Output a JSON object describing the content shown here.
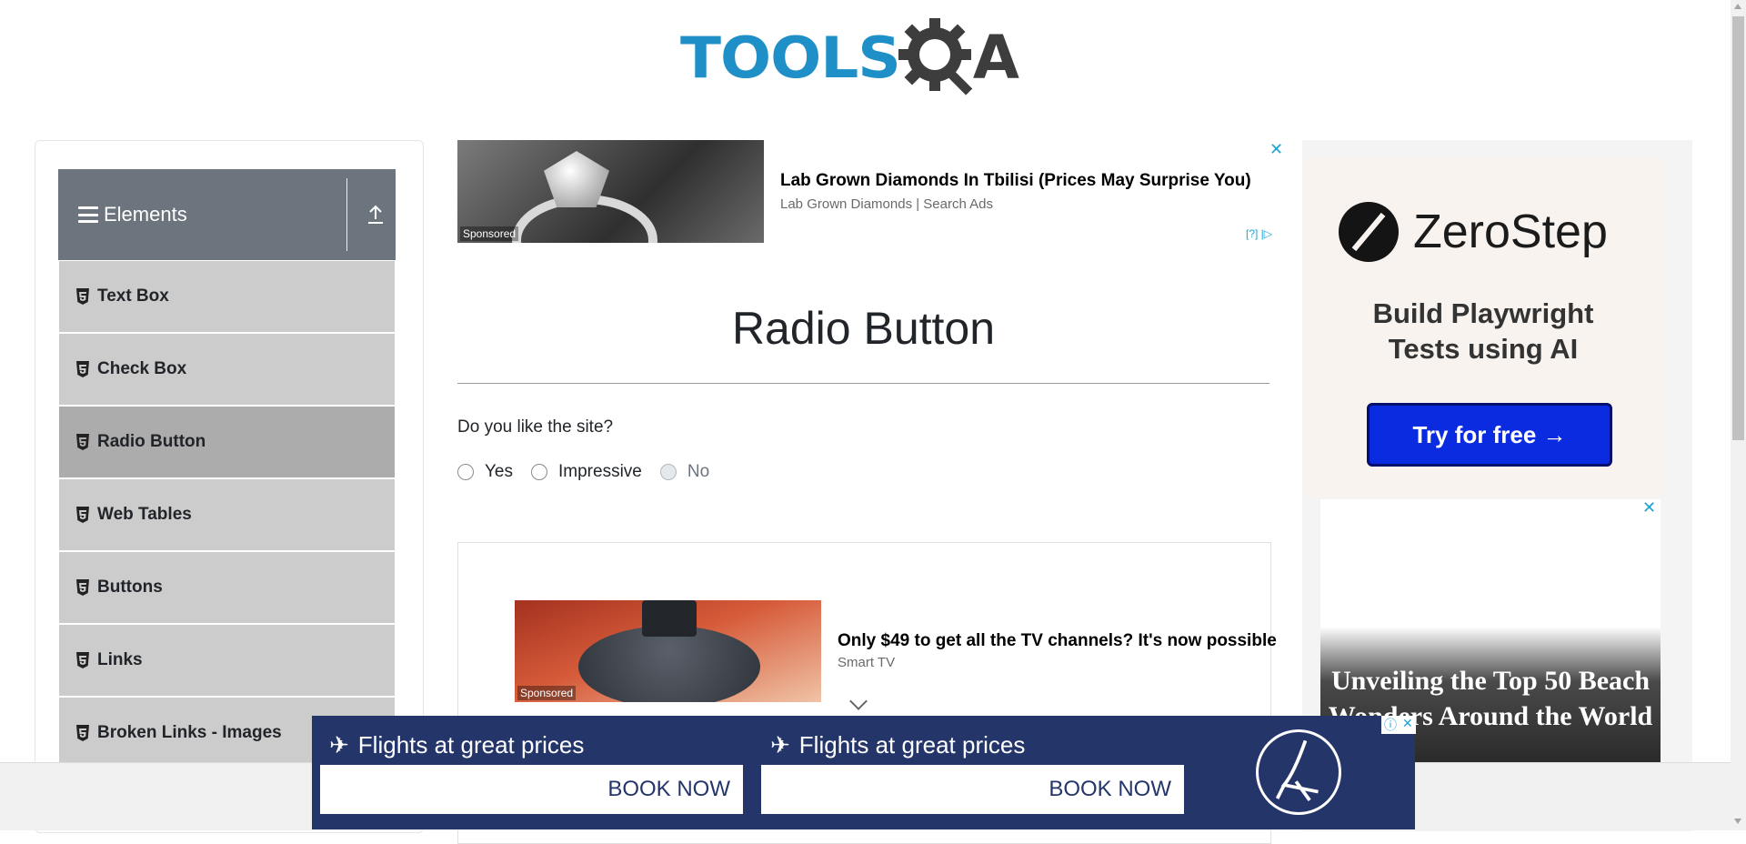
{
  "header": {
    "logo_tools": "TOOLS",
    "logo_a": "A"
  },
  "sidebar": {
    "group_title": "Elements",
    "items": [
      {
        "label": "Text Box",
        "active": false
      },
      {
        "label": "Check Box",
        "active": false
      },
      {
        "label": "Radio Button",
        "active": true
      },
      {
        "label": "Web Tables",
        "active": false
      },
      {
        "label": "Buttons",
        "active": false
      },
      {
        "label": "Links",
        "active": false
      },
      {
        "label": "Broken Links - Images",
        "active": false
      }
    ]
  },
  "top_ad": {
    "title": "Lab Grown Diamonds In Tbilisi (Prices May Surprise You)",
    "source": "Lab Grown Diamonds | Search Ads",
    "sponsored": "Sponsored",
    "choices": "[?]",
    "close": "✕"
  },
  "main": {
    "page_title": "Radio Button",
    "question": "Do you like the site?",
    "options": [
      {
        "label": "Yes",
        "disabled": false,
        "checked": false
      },
      {
        "label": "Impressive",
        "disabled": false,
        "checked": false
      },
      {
        "label": "No",
        "disabled": true,
        "checked": false
      }
    ]
  },
  "content_ad": {
    "title": "Only $49 to get all the TV channels? It's now possible",
    "source": "Smart TV",
    "sponsored": "Sponsored"
  },
  "right_ad": {
    "brand": "ZeroStep",
    "tagline_line1": "Build Playwright",
    "tagline_line2": "Tests using AI",
    "cta": "Try for free →"
  },
  "right_ad2": {
    "title": "Unveiling the Top 50 Beach Wonders Around the World",
    "close": "✕"
  },
  "bottom_ad": {
    "cards": [
      {
        "heading": "Flights at great prices",
        "cta": "BOOK NOW"
      },
      {
        "heading": "Flights at great prices",
        "cta": "BOOK NOW"
      }
    ],
    "info": "ⓘ",
    "close": "✕"
  },
  "colors": {
    "accent": "#1e8fc7",
    "sidebar_header": "#6c757d",
    "menu_item": "#cccccc",
    "menu_item_active": "#acacac",
    "cta_blue": "#0a2be0",
    "bottom_ad_bg": "#24356a"
  }
}
